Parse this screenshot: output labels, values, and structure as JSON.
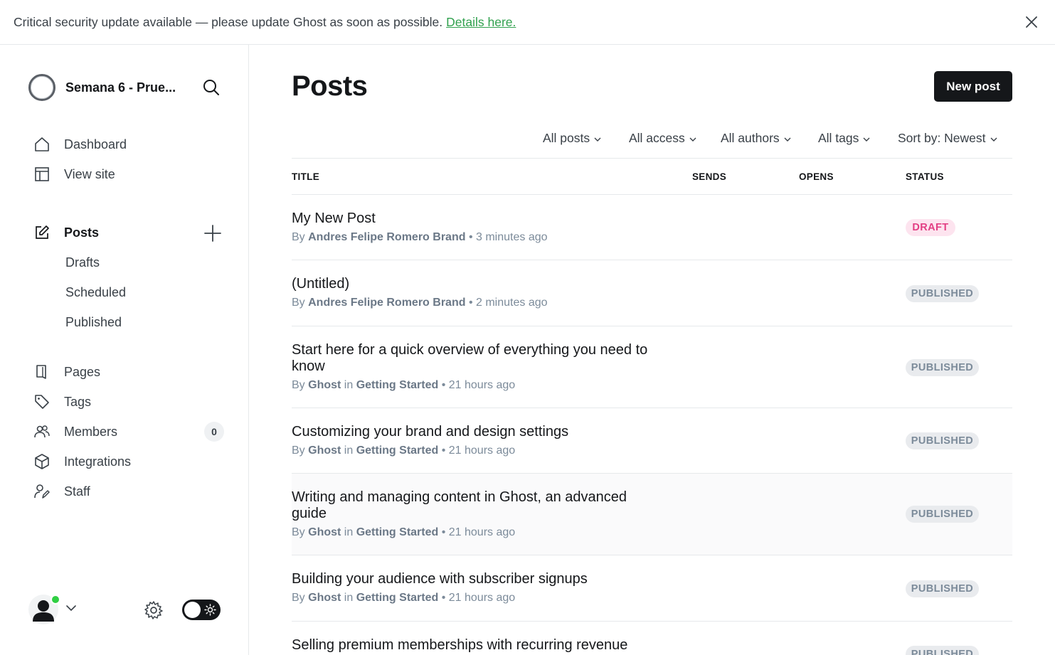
{
  "banner": {
    "message": "Critical security update available — please update Ghost as soon as possible.",
    "link_label": "Details here."
  },
  "sidebar": {
    "site_title": "Semana 6 - Prue...",
    "nav": {
      "dashboard": "Dashboard",
      "view_site": "View site",
      "posts": "Posts",
      "drafts": "Drafts",
      "scheduled": "Scheduled",
      "published": "Published",
      "pages": "Pages",
      "tags": "Tags",
      "members": "Members",
      "members_count": "0",
      "integrations": "Integrations",
      "staff": "Staff"
    }
  },
  "main": {
    "title": "Posts",
    "new_post_label": "New post",
    "filters": {
      "type": "All posts",
      "access": "All access",
      "authors": "All authors",
      "tags": "All tags",
      "sort": "Sort by: Newest"
    },
    "columns": {
      "title": "TITLE",
      "sends": "SENDS",
      "opens": "OPENS",
      "status": "STATUS"
    },
    "posts": [
      {
        "title": "My New Post",
        "by": "By",
        "author": "Andres Felipe Romero Brand",
        "in": "",
        "tag": "",
        "time": "• 3 minutes ago",
        "status": "DRAFT"
      },
      {
        "title": "(Untitled)",
        "by": "By",
        "author": "Andres Felipe Romero Brand",
        "in": "",
        "tag": "",
        "time": "• 2 minutes ago",
        "status": "PUBLISHED"
      },
      {
        "title": "Start here for a quick overview of everything you need to know",
        "by": "By",
        "author": "Ghost",
        "in": "in",
        "tag": "Getting Started",
        "time": "• 21 hours ago",
        "status": "PUBLISHED"
      },
      {
        "title": "Customizing your brand and design settings",
        "by": "By",
        "author": "Ghost",
        "in": "in",
        "tag": "Getting Started",
        "time": "• 21 hours ago",
        "status": "PUBLISHED"
      },
      {
        "title": "Writing and managing content in Ghost, an advanced guide",
        "by": "By",
        "author": "Ghost",
        "in": "in",
        "tag": "Getting Started",
        "time": "• 21 hours ago",
        "status": "PUBLISHED"
      },
      {
        "title": "Building your audience with subscriber signups",
        "by": "By",
        "author": "Ghost",
        "in": "in",
        "tag": "Getting Started",
        "time": "• 21 hours ago",
        "status": "PUBLISHED"
      },
      {
        "title": "Selling premium memberships with recurring revenue",
        "by": "",
        "author": "",
        "in": "",
        "tag": "",
        "time": "",
        "status": "PUBLISHED"
      }
    ]
  },
  "colors": {
    "accent_link": "#30a14e",
    "draft_bg": "#fde4ef",
    "draft_text": "#e33f84",
    "published_bg": "#e9ebee",
    "online": "#30cf43"
  }
}
